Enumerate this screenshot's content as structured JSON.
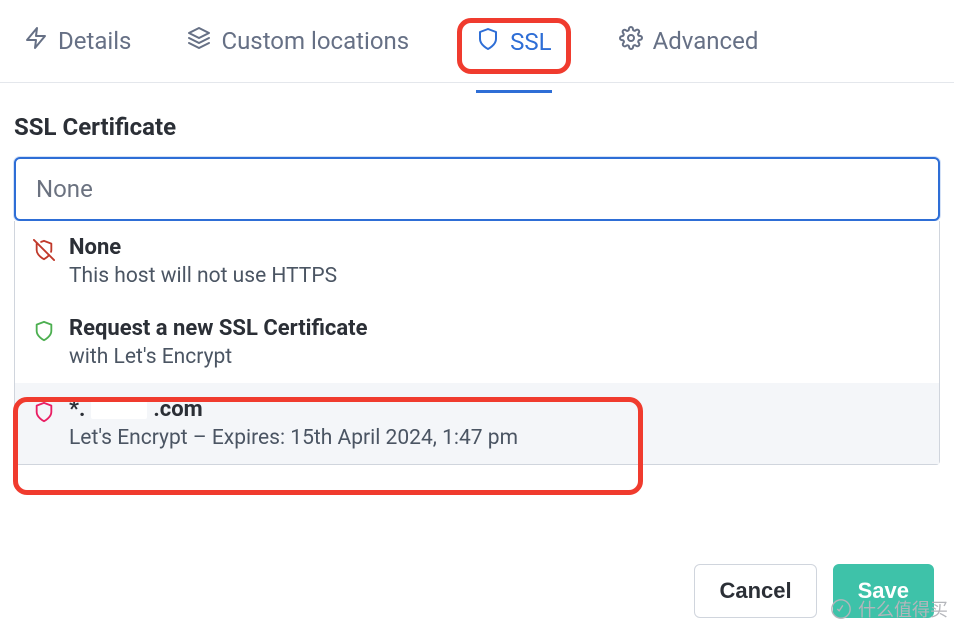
{
  "tabs": {
    "details": "Details",
    "custom_locations": "Custom locations",
    "ssl": "SSL",
    "advanced": "Advanced"
  },
  "section": {
    "label": "SSL Certificate",
    "selected": "None"
  },
  "options": {
    "none": {
      "title": "None",
      "sub": "This host will not use HTTPS"
    },
    "request": {
      "title": "Request a new SSL Certificate",
      "sub": "with Let's Encrypt"
    },
    "cert": {
      "title_prefix": "*.",
      "title_suffix": ".com",
      "sub": "Let's Encrypt – Expires: 15th April 2024, 1:47 pm"
    }
  },
  "buttons": {
    "cancel": "Cancel",
    "save": "Save"
  },
  "watermark": "什么值得买"
}
